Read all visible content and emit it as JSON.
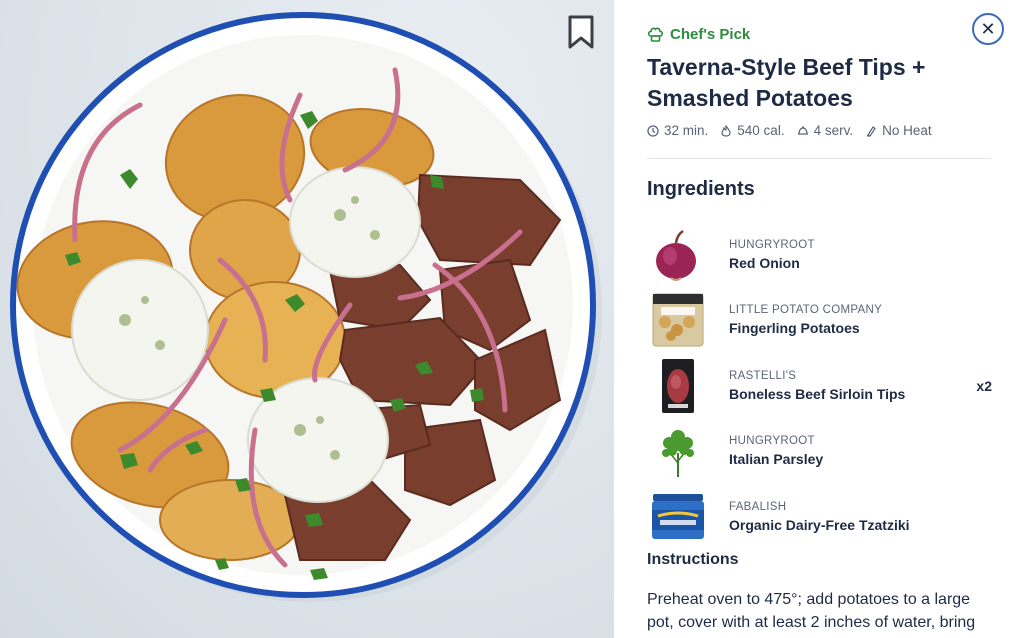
{
  "colors": {
    "accent_green": "#2e8b3e",
    "close_ring_blue": "#3d69b8",
    "text_dark": "#1f2a44",
    "text_muted": "#5b6477",
    "plate_rim": "#1f4fb3"
  },
  "photo": {
    "bookmark_icon": "bookmark-icon"
  },
  "header": {
    "badge_label": "Chef's Pick",
    "badge_icon": "chef-hat-icon",
    "close_icon": "close-icon",
    "title": "Taverna-Style Beef Tips + Smashed Potatoes"
  },
  "meta": [
    {
      "icon": "clock-icon",
      "label": "32 min."
    },
    {
      "icon": "flame-icon",
      "label": "540 cal."
    },
    {
      "icon": "serving-icon",
      "label": "4 serv."
    },
    {
      "icon": "no-heat-icon",
      "label": "No Heat"
    }
  ],
  "ingredients_heading": "Ingredients",
  "ingredients": [
    {
      "brand": "HUNGRYROOT",
      "name": "Red Onion",
      "qty": ""
    },
    {
      "brand": "LITTLE POTATO COMPANY",
      "name": "Fingerling Potatoes",
      "qty": ""
    },
    {
      "brand": "RASTELLI'S",
      "name": "Boneless Beef Sirloin Tips",
      "qty": "x2"
    },
    {
      "brand": "HUNGRYROOT",
      "name": "Italian Parsley",
      "qty": ""
    },
    {
      "brand": "FABALISH",
      "name": "Organic Dairy-Free Tzatziki",
      "qty": ""
    }
  ],
  "instructions_heading": "Instructions",
  "instructions_text": "Preheat oven to 475°; add potatoes to a large pot, cover with at least 2 inches of water, bring"
}
